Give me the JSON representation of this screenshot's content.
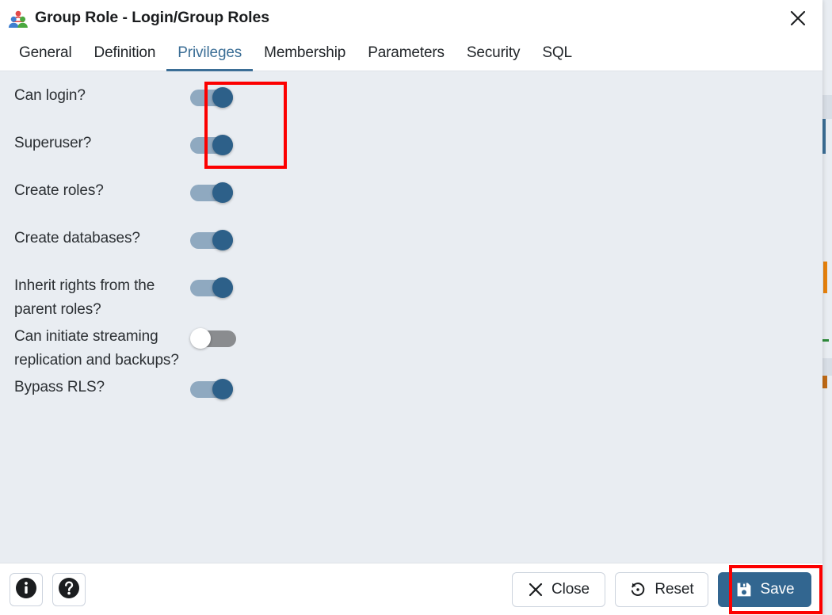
{
  "dialog": {
    "title": "Group Role - Login/Group Roles",
    "title_icon": "group-role-icon",
    "close_icon": "close-icon"
  },
  "tabs": [
    {
      "label": "General",
      "active": false
    },
    {
      "label": "Definition",
      "active": false
    },
    {
      "label": "Privileges",
      "active": true
    },
    {
      "label": "Membership",
      "active": false
    },
    {
      "label": "Parameters",
      "active": false
    },
    {
      "label": "Security",
      "active": false
    },
    {
      "label": "SQL",
      "active": false
    }
  ],
  "privileges": [
    {
      "label": "Can login?",
      "value": "on",
      "name": "can-login"
    },
    {
      "label": "Superuser?",
      "value": "on",
      "name": "superuser"
    },
    {
      "label": "Create roles?",
      "value": "on",
      "name": "create-roles"
    },
    {
      "label": "Create databases?",
      "value": "on",
      "name": "create-databases"
    },
    {
      "label": "Inherit rights from the parent roles?",
      "value": "on",
      "name": "inherit-rights"
    },
    {
      "label": "Can initiate streaming replication and backups?",
      "value": "off",
      "name": "can-initiate-replication"
    },
    {
      "label": "Bypass RLS?",
      "value": "on",
      "name": "bypass-rls"
    }
  ],
  "footer": {
    "info_icon": "info-icon",
    "help_icon": "help-icon",
    "close_label": "Close",
    "close_icon": "x-icon",
    "reset_label": "Reset",
    "reset_icon": "reset-circular-arrow-icon",
    "save_label": "Save",
    "save_icon": "save-floppy-icon"
  },
  "highlights": [
    {
      "name": "highlight-first-two-toggles",
      "color": "#fc0000"
    },
    {
      "name": "highlight-save-button",
      "color": "#fc0000"
    }
  ],
  "colors": {
    "accent": "#326690",
    "tab_active": "#3b6e96",
    "panel_bg": "#e9edf2",
    "toggle_on_track": "#8fa9c0",
    "toggle_on_thumb": "#2d6089",
    "toggle_off_track": "#8a8c8f",
    "highlight": "#fc0000"
  }
}
